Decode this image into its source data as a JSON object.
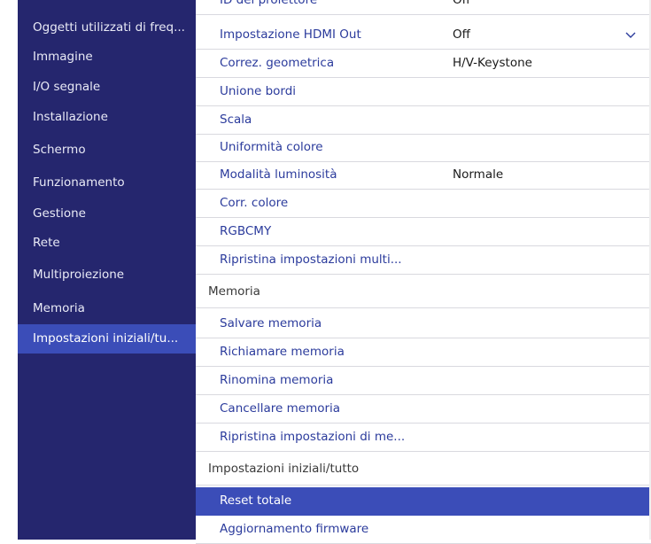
{
  "sidebar": {
    "items": [
      {
        "label": "Oggetti utilizzati di freq..."
      },
      {
        "label": "Immagine"
      },
      {
        "label": "I/O segnale"
      },
      {
        "label": "Installazione"
      },
      {
        "label": "Schermo"
      },
      {
        "label": "Funzionamento"
      },
      {
        "label": "Gestione"
      },
      {
        "label": "Rete"
      },
      {
        "label": "Multiproiezione"
      },
      {
        "label": "Memoria"
      },
      {
        "label": "Impostazioni iniziali/tu..."
      }
    ],
    "active_index": 10
  },
  "main": {
    "top_cut": {
      "label": "ID del proiettore",
      "value": "Off"
    },
    "rows_group1": [
      {
        "label": "Impostazione HDMI Out",
        "value": "Off"
      },
      {
        "label": "Correz. geometrica",
        "value": "H/V-Keystone"
      },
      {
        "label": "Unione bordi",
        "value": ""
      },
      {
        "label": "Scala",
        "value": ""
      },
      {
        "label": "Uniformità colore",
        "value": ""
      },
      {
        "label": "Modalità luminosità",
        "value": "Normale"
      },
      {
        "label": "Corr. colore",
        "value": ""
      },
      {
        "label": "RGBCMY",
        "value": ""
      },
      {
        "label": "Ripristina impostazioni multi...",
        "value": ""
      }
    ],
    "section_memoria": "Memoria",
    "rows_group2": [
      {
        "label": "Salvare memoria"
      },
      {
        "label": "Richiamare memoria"
      },
      {
        "label": "Rinomina memoria"
      },
      {
        "label": "Cancellare memoria"
      },
      {
        "label": "Ripristina impostazioni di me..."
      }
    ],
    "section_impostazioni": "Impostazioni iniziali/tutto",
    "rows_group3": [
      {
        "label": "Reset totale"
      },
      {
        "label": "Aggiornamento firmware"
      }
    ]
  }
}
